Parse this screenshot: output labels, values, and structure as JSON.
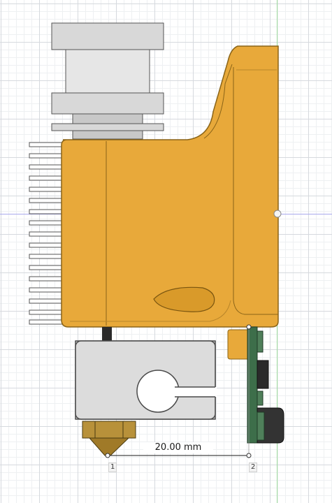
{
  "viewport": {
    "background": "#ffffff",
    "grid_minor": "#eef0f2",
    "grid_major": "#d6d9de",
    "y_axis_color": "#9fdc9f",
    "x_axis_color": "#a9a9ee"
  },
  "model": {
    "parts": [
      "heatsink",
      "shroud",
      "heater-block",
      "nozzle",
      "sensor-pcb",
      "fan-fins"
    ],
    "colors": {
      "shroud": "#e8a93a",
      "shroud_edge": "#8a6418",
      "metal": "#d9d9d9",
      "metal_edge": "#4a4a4a",
      "brass": "#b8913a",
      "pcb": "#3d6e4a",
      "dark": "#2a2a2a"
    }
  },
  "measurement": {
    "value": "20.00 mm",
    "point_1": "1",
    "point_2": "2"
  }
}
